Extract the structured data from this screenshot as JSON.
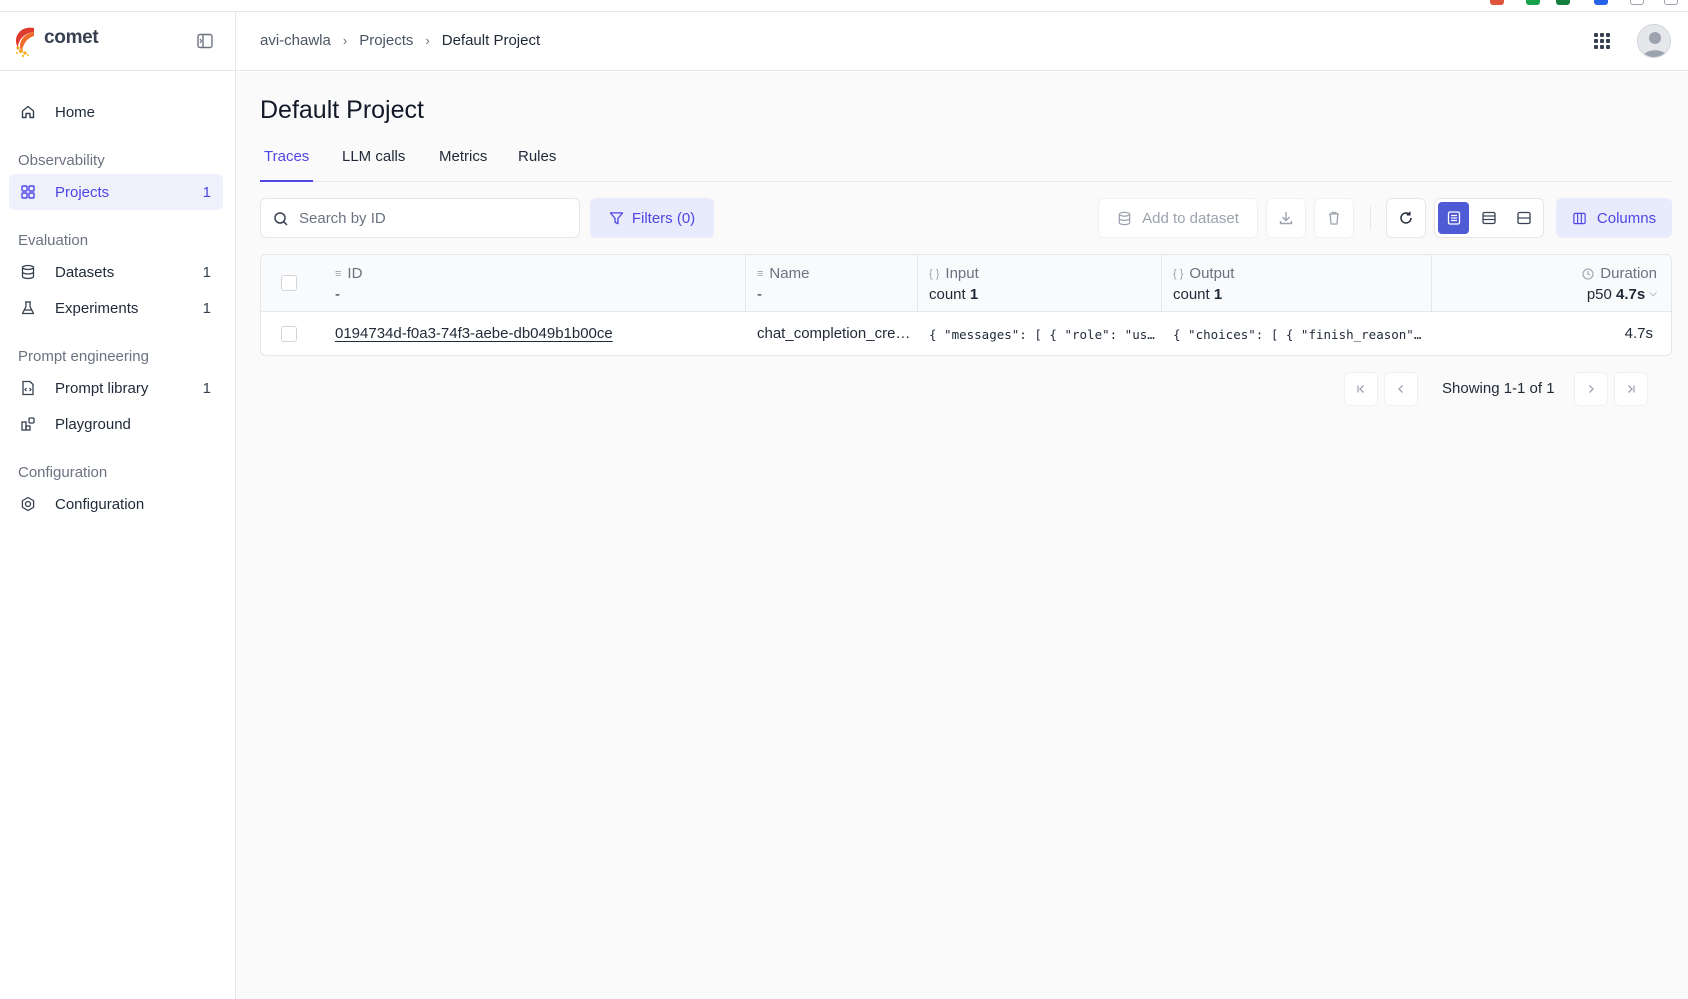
{
  "app": {
    "name": "comet"
  },
  "sidebar": {
    "items": [
      {
        "label": "Home"
      },
      {
        "label": "Projects",
        "count": "1"
      },
      {
        "label": "Datasets",
        "count": "1"
      },
      {
        "label": "Experiments",
        "count": "1"
      },
      {
        "label": "Prompt library",
        "count": "1"
      },
      {
        "label": "Playground"
      },
      {
        "label": "Configuration"
      }
    ],
    "sections": [
      "Observability",
      "Evaluation",
      "Prompt engineering",
      "Configuration"
    ]
  },
  "breadcrumb": [
    "avi-chawla",
    "Projects",
    "Default Project"
  ],
  "page": {
    "title": "Default Project"
  },
  "tabs": [
    {
      "label": "Traces",
      "active": true
    },
    {
      "label": "LLM calls"
    },
    {
      "label": "Metrics"
    },
    {
      "label": "Rules"
    }
  ],
  "toolbar": {
    "search_placeholder": "Search by ID",
    "filters_label": "Filters (0)",
    "add_to_dataset_label": "Add to dataset",
    "columns_label": "Columns"
  },
  "table": {
    "columns": [
      {
        "label": "ID",
        "sub": "-"
      },
      {
        "label": "Name",
        "sub": "-"
      },
      {
        "label": "Input",
        "sub_prefix": "count",
        "sub_value": "1"
      },
      {
        "label": "Output",
        "sub_prefix": "count",
        "sub_value": "1"
      },
      {
        "label": "Duration",
        "sub_prefix": "p50",
        "sub_value": "4.7s"
      }
    ],
    "rows": [
      {
        "id": "0194734d-f0a3-74f3-aebe-db049b1b00ce",
        "name": "chat_completion_create",
        "input": "{ \"messages\": [ { \"role\": \"user…",
        "output": "{ \"choices\": [ { \"finish_reason\": \"…",
        "duration": "4.7s"
      }
    ]
  },
  "pagination": {
    "text": "Showing 1-1 of 1"
  },
  "colors": {
    "accent": "#4f46e5",
    "accent_bg": "#e8ebfb",
    "brand_red": "#e03a2f",
    "brand_orange": "#f5a524"
  }
}
